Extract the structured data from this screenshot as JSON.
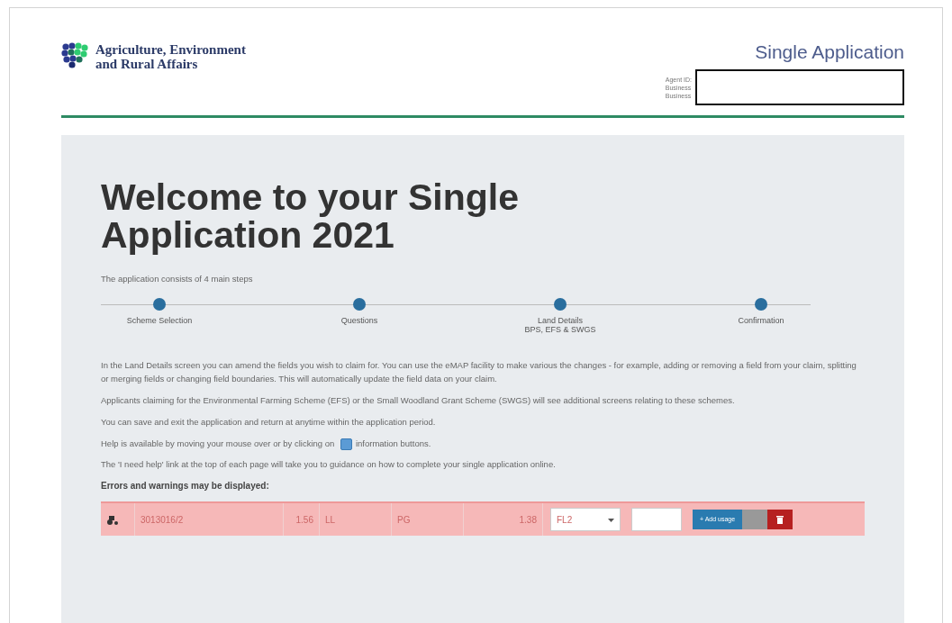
{
  "header": {
    "org_name": [
      "Agriculture, Environment",
      "and Rural Affairs"
    ],
    "app_title": "Single Application",
    "details_labels": [
      "Agent ID:",
      "Business",
      "Business"
    ]
  },
  "welcome": {
    "heading": [
      "Welcome to your Single",
      "Application 2021"
    ],
    "intro": "The application consists of 4 main steps",
    "steps": [
      {
        "label": [
          "Scheme Selection"
        ]
      },
      {
        "label": [
          "Questions"
        ]
      },
      {
        "label": [
          "Land Details",
          "BPS, EFS & SWGS"
        ]
      },
      {
        "label": [
          "Confirmation"
        ]
      }
    ],
    "paragraphs": [
      {
        "kind": "text",
        "text": "In the Land Details screen you can amend the fields you wish to claim for. You can use the eMAP facility to make various the changes - for example, adding or removing a field from your claim, splitting or merging fields or changing field boundaries. This will automatically update the field data on your claim."
      },
      {
        "kind": "text",
        "text": "Applicants claiming for the Environmental Farming Scheme (EFS) or the Small Woodland Grant Scheme (SWGS) will see additional screens relating to these schemes."
      },
      {
        "kind": "text",
        "text": "You can save and exit the application and return at anytime within the application period."
      },
      {
        "kind": "info",
        "before": "Help is available by moving your mouse over or by clicking on",
        "after": "information buttons."
      },
      {
        "kind": "text",
        "text": "The 'I need help' link at the top of each page will take you to guidance on how to complete your single application online."
      }
    ],
    "errors_heading": "Errors and warnings may be displayed:",
    "example_row": {
      "field": "3013016/2",
      "area": "1.56",
      "code": "LL",
      "use": "PG",
      "claimed": "1.38",
      "select_value": "FL2",
      "add_button": "+ Add usage"
    }
  }
}
